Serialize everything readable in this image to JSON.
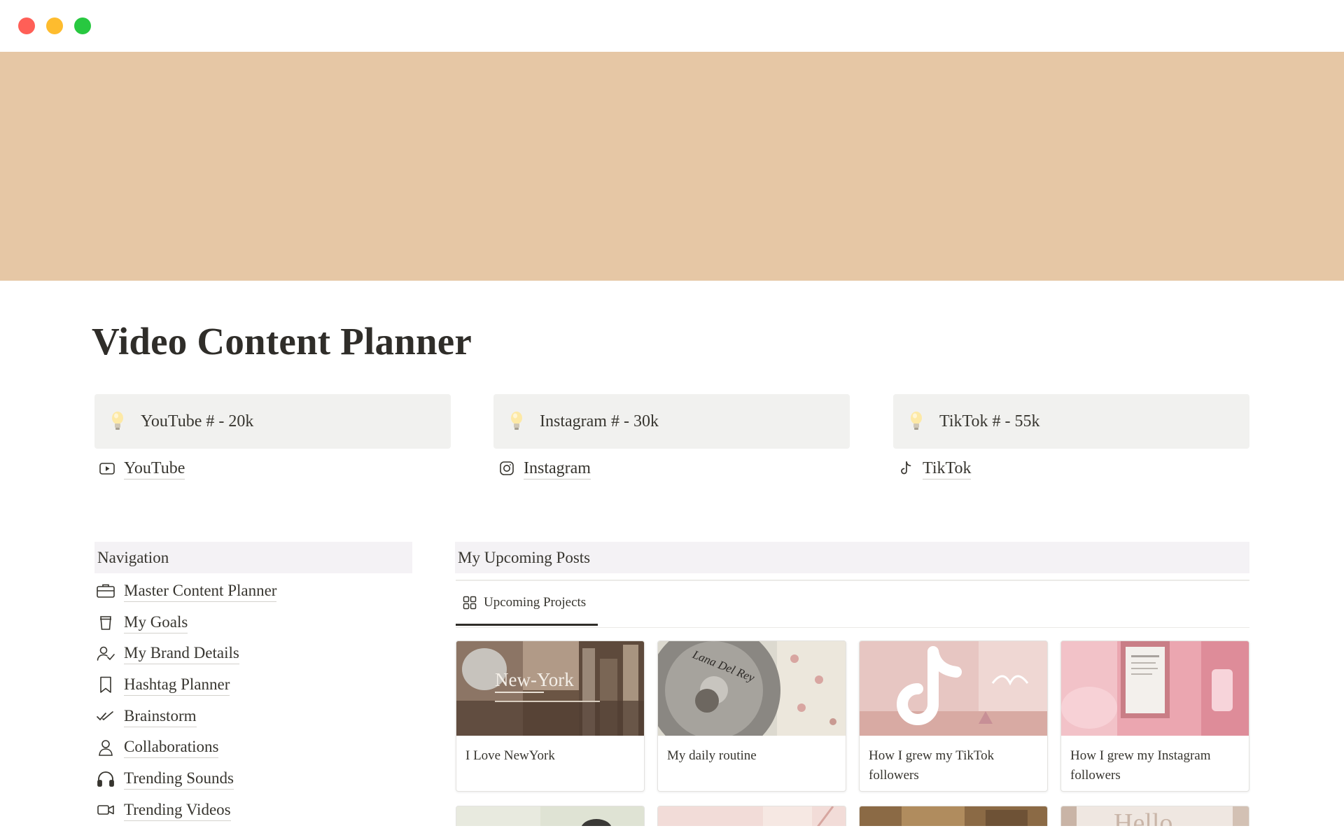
{
  "window": {
    "controls": [
      "close",
      "minimize",
      "maximize"
    ],
    "colors": {
      "close": "#ff5f57",
      "minimize": "#febc2e",
      "maximize": "#28c840"
    }
  },
  "cover": {
    "color": "#e6c7a5"
  },
  "page": {
    "title": "Video Content Planner"
  },
  "callouts": [
    {
      "icon": "lightbulb-icon",
      "text": "YouTube # - 20k"
    },
    {
      "icon": "lightbulb-icon",
      "text": "Instagram # - 30k"
    },
    {
      "icon": "lightbulb-icon",
      "text": "TikTok # - 55k"
    }
  ],
  "platform_links": [
    {
      "icon": "youtube-play-icon",
      "label": "YouTube"
    },
    {
      "icon": "instagram-icon",
      "label": "Instagram"
    },
    {
      "icon": "tiktok-icon",
      "label": "TikTok"
    }
  ],
  "navigation": {
    "heading": "Navigation",
    "items": [
      {
        "icon": "briefcase-icon",
        "label": "Master Content Planner"
      },
      {
        "icon": "cup-icon",
        "label": "My Goals"
      },
      {
        "icon": "person-check-icon",
        "label": "My Brand Details"
      },
      {
        "icon": "bookmark-icon",
        "label": "Hashtag Planner"
      },
      {
        "icon": "double-check-icon",
        "label": "Brainstorm"
      },
      {
        "icon": "person-icon",
        "label": "Collaborations"
      },
      {
        "icon": "headphones-icon",
        "label": "Trending Sounds"
      },
      {
        "icon": "video-camera-icon",
        "label": "Trending Videos"
      }
    ]
  },
  "upcoming": {
    "heading": "My Upcoming Posts",
    "view_tab": {
      "icon": "gallery-grid-icon",
      "label": "Upcoming Projects"
    },
    "cards": [
      {
        "title": "I Love NewYork",
        "thumb_caption": "New-York"
      },
      {
        "title": "My daily routine",
        "thumb_caption": "Lana Del Rey"
      },
      {
        "title": "How I grew my TikTok followers"
      },
      {
        "title": "How I grew my Instagram followers"
      }
    ],
    "partial_cards": [
      {
        "thumb_caption": ""
      },
      {
        "thumb_caption": ""
      },
      {
        "thumb_caption": ""
      },
      {
        "thumb_caption": "Hello"
      }
    ]
  }
}
